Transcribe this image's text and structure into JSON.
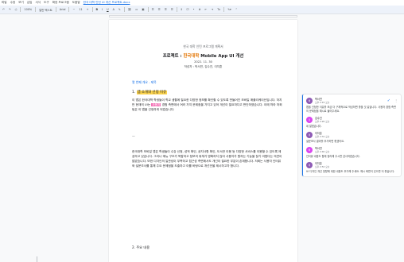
{
  "menubar": {
    "items": [
      "파일",
      "수정",
      "보기",
      "삽입",
      "서식",
      "도구",
      "확장 프로그램",
      "도움말"
    ],
    "doc_title": "한국 대학 인턴 UI 개선 프로젝트.docx"
  },
  "toolbar": {
    "zoom": "100%",
    "style": "일반 텍스트",
    "font": "Arial",
    "font_size": "11"
  },
  "document": {
    "header": "한국 대학 인턴 프로그램 계획서",
    "title_prefix": "프로젝트 :",
    "title_accent": "한국대학",
    "title_suffix": "Mobile App UI 개선",
    "date": "2022. 11. 30",
    "author": "작성자 : 박서연, 김수진, 이지훈",
    "toc_link": "열 번째 개요 - 제목",
    "section1_num": "1.",
    "section1_title": "앱 소개와 선정 이유",
    "para1_a": "이 앱은 한국대학 학생들이 학교 생활에 필요한 다양한 정보를 확인할 수 있도록 만들어진 모바일 애플리케이션입니다. 하지만 현재의 UI는",
    "para1_hl": "사용자",
    "para1_b": "경험 측면에서 여러 가지 문제점을 가지고 있어 개선이 필요하다고 판단하였습니다. 이에 따라 저희 팀은 이 앱을 선정하게 되었습니다.",
    "dash": "—",
    "para2": "한국대학 모바일 앱은 학생들이 수강 신청, 성적 확인, 공지사항 확인, 도서관 이용 등 다양한 서비스를 이용할 수 있도록 제공하고 있습니다. 그러나 메뉴 구조가 복잡하고 정보의 위계가 명확하지 않아 사용자가 원하는 기능을 찾기 어렵다는 의견이 많았습니다. 또한 디자인의 일관성이 부족하고 접근성 측면에서도 개선이 필요한 부분이 존재합니다. 저희는 사용자 인터뷰와 설문조사를 통해 주요 문제점을 도출하고 이를 바탕으로 개선안을 제시하고자 합니다.",
    "section2": "2. 주요 내용"
  },
  "comments": [
    {
      "name": "박서연",
      "time": "오후 2:15 오늘",
      "text": "앱을 선정한 이유를 조금 더 구체적으로 작성하면 좋을 것 같습니다. 사용자 경험 측면의 문제점을 예시로 들어주세요.",
      "avatar_color": "#8e5bb5",
      "initial": "박"
    },
    {
      "name": "김수진",
      "time": "오후 2:20 오늘",
      "text": "네 알겠습니다.",
      "avatar_color": "#d946ef",
      "initial": "김"
    },
    {
      "name": "이지훈",
      "time": "오후 2:31 오늘",
      "text": "설문조사 결과를 추가하면 좋겠어요.",
      "avatar_color": "#8e5bb5",
      "initial": "이"
    },
    {
      "name": "박서연",
      "time": "오후 2:40 오늘",
      "text": "인터뷰 내용도 함께 정리해 주시면 감사하겠습니다.",
      "avatar_color": "#d946ef",
      "initial": "박"
    },
    {
      "name": "이지훈",
      "time": "오후 2:52 오늘",
      "text": "UI 디자인 개선 방향에 대한 내용도 추가해 주세요. 예시 화면이 있으면 더 좋습니다.",
      "avatar_color": "#8e5bb5",
      "initial": "이"
    }
  ],
  "colors": {
    "accent": "#1a73e8",
    "title_accent": "#e37400",
    "highlight_yellow": "#fbd34d",
    "highlight_pink": "#f472b6"
  }
}
